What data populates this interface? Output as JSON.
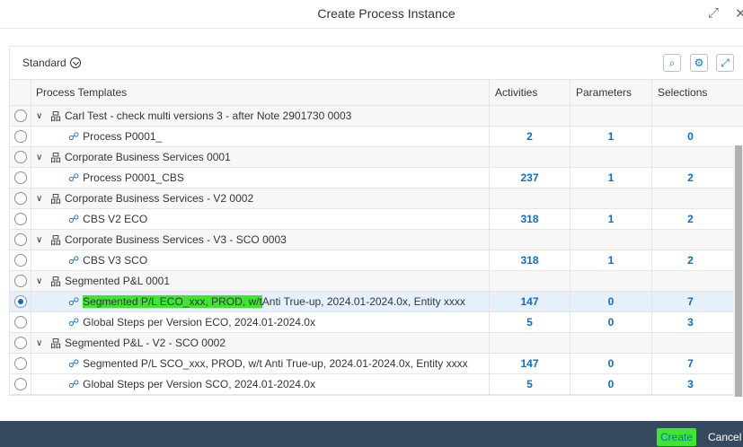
{
  "dialog": {
    "title": "Create Process Instance"
  },
  "toolbar": {
    "variant": "Standard"
  },
  "columns": {
    "templates": "Process Templates",
    "activities": "Activities",
    "parameters": "Parameters",
    "selections": "Selections"
  },
  "rows": [
    {
      "type": "group",
      "label": "Carl Test - check multi versions 3 - after Note 2901730  0003"
    },
    {
      "type": "item",
      "label": "Process P0001_",
      "activities": "2",
      "parameters": "1",
      "selections": "0"
    },
    {
      "type": "group",
      "label": "Corporate Business Services  0001"
    },
    {
      "type": "item",
      "label": "Process P0001_CBS",
      "activities": "237",
      "parameters": "1",
      "selections": "2"
    },
    {
      "type": "group",
      "label": "Corporate Business Services - V2  0002"
    },
    {
      "type": "item",
      "label": "CBS V2 ECO",
      "activities": "318",
      "parameters": "1",
      "selections": "2"
    },
    {
      "type": "group",
      "label": "Corporate Business Services - V3 - SCO  0003"
    },
    {
      "type": "item",
      "label": "CBS V3 SCO",
      "activities": "318",
      "parameters": "1",
      "selections": "2"
    },
    {
      "type": "group",
      "label": "Segmented P&L  0001"
    },
    {
      "type": "item",
      "label_hl": "Segmented P/L ECO_xxx, PROD, w/t ",
      "label": "Anti True-up, 2024.01-2024.0x, Entity xxxx",
      "activities": "147",
      "parameters": "0",
      "selections": "7"
    },
    {
      "type": "item",
      "label": "Global Steps per Version ECO, 2024.01-2024.0x",
      "activities": "5",
      "parameters": "0",
      "selections": "3"
    },
    {
      "type": "group",
      "label": "Segmented P&L - V2 - SCO  0002"
    },
    {
      "type": "item",
      "label": "Segmented P/L SCO_xxx, PROD, w/t Anti True-up, 2024.01-2024.0x, Entity xxxx",
      "activities": "147",
      "parameters": "0",
      "selections": "7"
    },
    {
      "type": "item",
      "label": "Global Steps per Version SCO, 2024.01-2024.0x",
      "activities": "5",
      "parameters": "0",
      "selections": "3"
    }
  ],
  "footer": {
    "create": "Create",
    "cancel": "Cancel"
  },
  "colors": {
    "accent": "#0a6ed1",
    "highlight": "#3ee62e",
    "footer": "#354a5f"
  }
}
